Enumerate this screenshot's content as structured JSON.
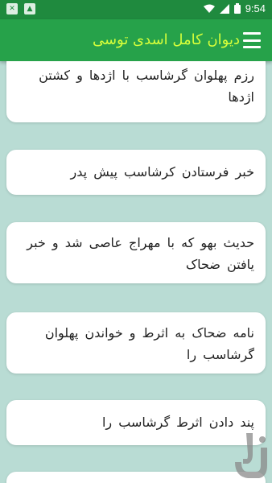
{
  "status_bar": {
    "time": "9:54",
    "left_icons": [
      "blocked-icon",
      "image-icon"
    ],
    "right_icons": [
      "wifi-icon",
      "signal-icon",
      "battery-icon"
    ]
  },
  "app_bar": {
    "title": "دیوان کامل اسدی توسی",
    "menu_icon": "hamburger-menu-icon"
  },
  "colors": {
    "status_bar": "#1f8a3e",
    "app_bar": "#26a24a",
    "title_text": "#d6ff3a",
    "background": "#b9dcd4",
    "card": "#ffffff"
  },
  "items": [
    {
      "label": "رزم پهلوان گرشاسب با اژدها و کشتن اژدها"
    },
    {
      "label": "خبر فرستادن کرشاسب پیش پدر"
    },
    {
      "label": "حدیث بهو که با مهراج عاصی شد و خبر یافتن ضحاک"
    },
    {
      "label": "نامه ضحاک به اثرط و خواندن پهلوان گرشاسب را"
    },
    {
      "label": "پند دادن اثرط گرشاسب را"
    },
    {
      "label": ""
    }
  ]
}
